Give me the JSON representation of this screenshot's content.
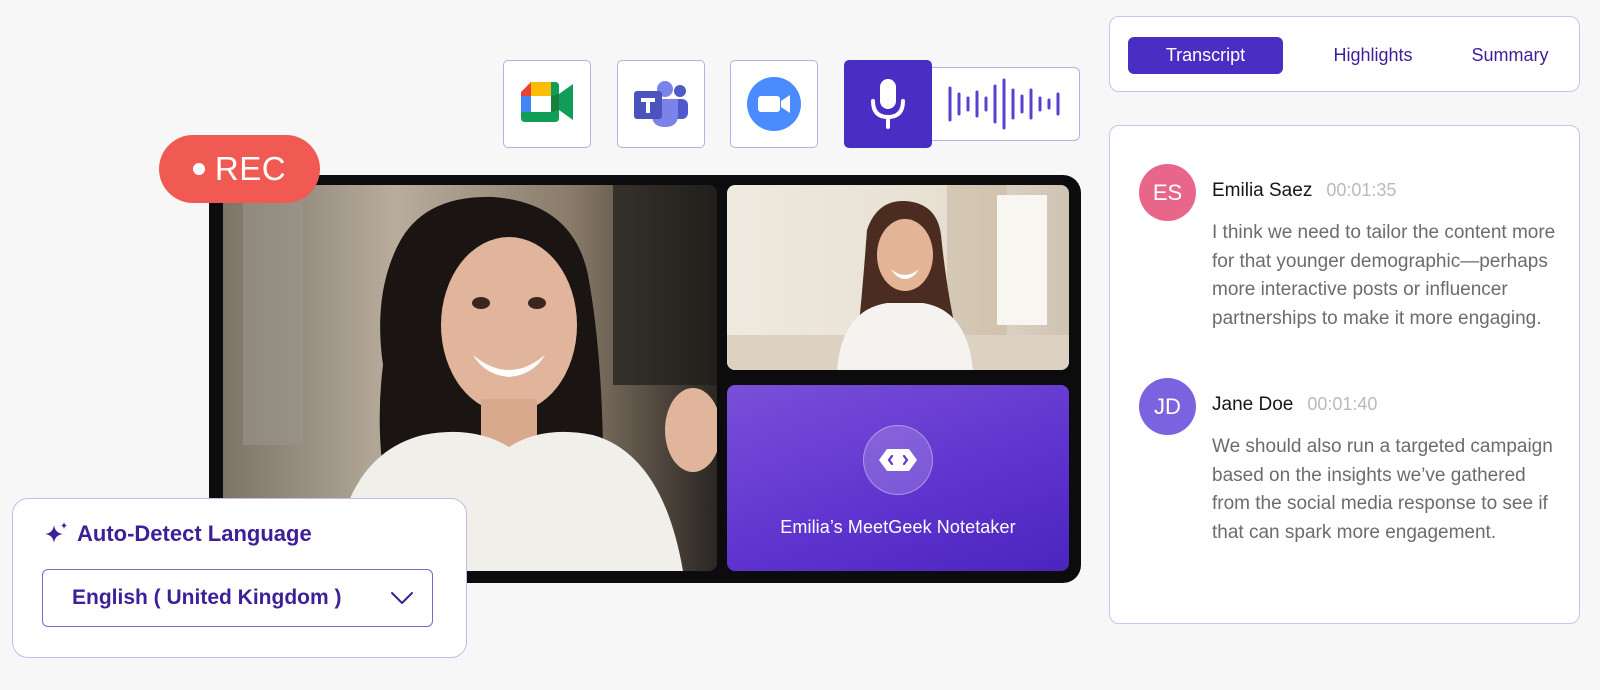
{
  "recording": {
    "label": "REC"
  },
  "platforms": [
    {
      "name": "google-meet-icon"
    },
    {
      "name": "microsoft-teams-icon"
    },
    {
      "name": "zoom-icon"
    }
  ],
  "audio": {
    "mic_icon": "microphone-icon",
    "wave_icon": "audio-waveform-icon"
  },
  "notetaker": {
    "label": "Emilia’s MeetGeek Notetaker",
    "icon": "robot-face-icon"
  },
  "language": {
    "title": "Auto-Detect Language",
    "selected": "English ( United Kingdom )"
  },
  "tabs": [
    {
      "label": "Transcript",
      "active": true
    },
    {
      "label": "Highlights",
      "active": false
    },
    {
      "label": "Summary",
      "active": false
    }
  ],
  "transcript": [
    {
      "initials": "ES",
      "name": "Emilia Saez",
      "time": "00:01:35",
      "color": "#e8668a",
      "text": "I think we need to tailor the content more for that younger demographic—perhaps more interactive posts or influencer partnerships to make it more engaging."
    },
    {
      "initials": "JD",
      "name": "Jane Doe",
      "time": "00:01:40",
      "color": "#7b63df",
      "text": "We should also run a targeted campaign based on the insights we’ve gathered from the social media response to see if that can spark more engagement."
    }
  ],
  "colors": {
    "accent": "#4a2dc3",
    "rec": "#f05a52",
    "border": "#cbc2ee"
  }
}
